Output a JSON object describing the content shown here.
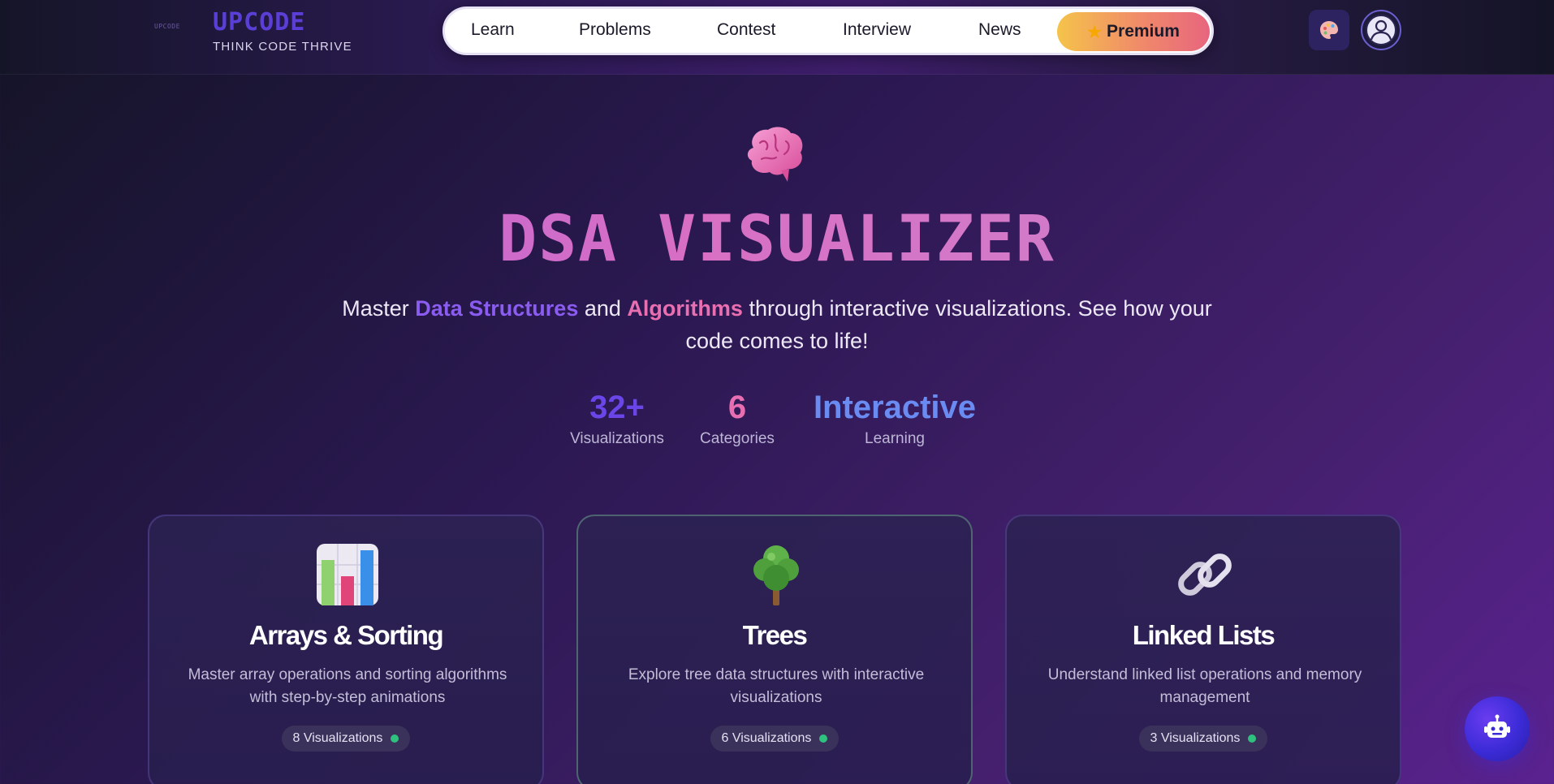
{
  "header": {
    "logo_mark": "UPCODE",
    "logo_title": "UPCODE",
    "logo_tagline": "THINK CODE THRIVE",
    "nav": [
      {
        "label": "Learn"
      },
      {
        "label": "Problems"
      },
      {
        "label": "Contest"
      },
      {
        "label": "Interview"
      },
      {
        "label": "News"
      }
    ],
    "premium_label": "Premium",
    "icons": {
      "premium": "star-icon",
      "theme": "palette-icon",
      "profile": "user-avatar-icon"
    }
  },
  "hero": {
    "icon": "brain-icon",
    "title": "DSA VISUALIZER",
    "subtitle_parts": {
      "p1": "Master ",
      "ds": "Data Structures",
      "p2": " and ",
      "alg": "Algorithms",
      "p3": " through interactive visualizations. See how your code comes to life!"
    },
    "stats": [
      {
        "value": "32+",
        "label": "Visualizations",
        "color": "#6a45e8"
      },
      {
        "value": "6",
        "label": "Categories",
        "color": "#e76fb1"
      },
      {
        "value": "Interactive",
        "label": "Learning",
        "color": "#6a8cf2"
      }
    ]
  },
  "cards": [
    {
      "icon": "bar-chart-icon",
      "title": "Arrays & Sorting",
      "description": "Master array operations and sorting algorithms with step-by-step animations",
      "badge": "8 Visualizations"
    },
    {
      "icon": "tree-icon",
      "title": "Trees",
      "description": "Explore tree data structures with interactive visualizations",
      "badge": "6 Visualizations"
    },
    {
      "icon": "chain-link-icon",
      "title": "Linked Lists",
      "description": "Understand linked list operations and memory management",
      "badge": "3 Visualizations"
    }
  ],
  "assistant": {
    "icon": "robot-icon"
  },
  "colors": {
    "accent_purple": "#6a45e8",
    "accent_pink": "#e76fb1",
    "badge_dot": "#2ec27e"
  }
}
